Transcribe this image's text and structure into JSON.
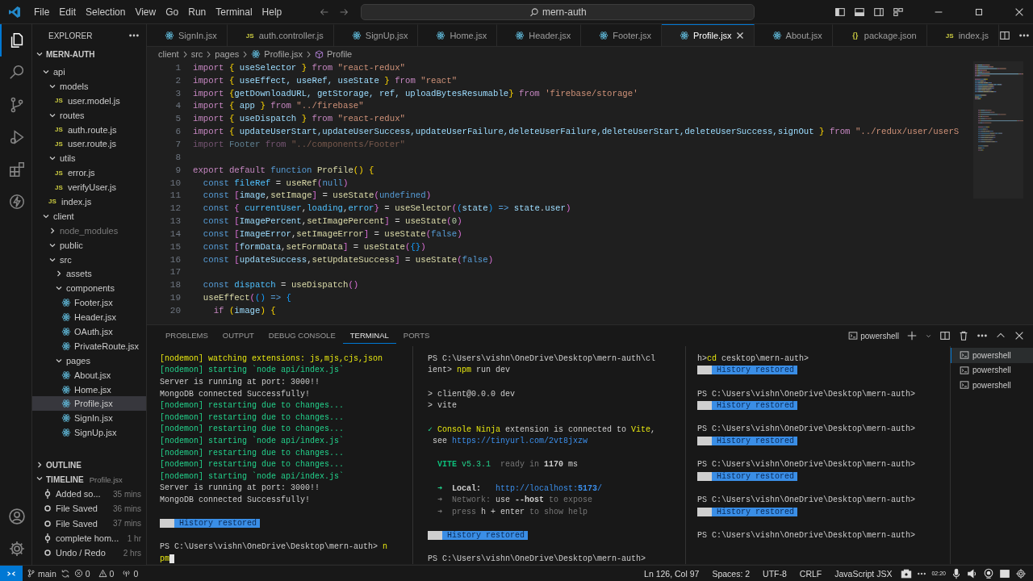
{
  "menu": [
    "File",
    "Edit",
    "Selection",
    "View",
    "Go",
    "Run",
    "Terminal",
    "Help"
  ],
  "command_center": {
    "value": "mern-auth"
  },
  "activity_bar": [
    {
      "kind": "files",
      "selected": true
    },
    {
      "kind": "search",
      "selected": false
    },
    {
      "kind": "branch",
      "selected": false
    },
    {
      "kind": "debug",
      "selected": false
    },
    {
      "kind": "extensions",
      "selected": false
    },
    {
      "kind": "bolt",
      "selected": false
    }
  ],
  "sidebar": {
    "title": "EXPLORER",
    "project": "MERN-AUTH",
    "tree": [
      {
        "name": "api",
        "kind": "folder",
        "expanded": true,
        "selected": false,
        "children": [
          {
            "name": "models",
            "kind": "folder",
            "expanded": true,
            "selected": false,
            "children": [
              {
                "name": "user.model.js",
                "kind": "js",
                "icon_text": "JS",
                "selected": false
              }
            ]
          },
          {
            "name": "routes",
            "kind": "folder",
            "expanded": true,
            "selected": false,
            "children": [
              {
                "name": "auth.route.js",
                "kind": "js",
                "icon_text": "JS",
                "selected": false
              },
              {
                "name": "user.route.js",
                "kind": "js",
                "icon_text": "JS",
                "selected": false
              }
            ]
          },
          {
            "name": "utils",
            "kind": "folder",
            "expanded": true,
            "selected": false,
            "children": [
              {
                "name": "error.js",
                "kind": "js",
                "icon_text": "JS",
                "selected": false
              },
              {
                "name": "verifyUser.js",
                "kind": "js",
                "icon_text": "JS",
                "selected": false
              }
            ]
          },
          {
            "name": "index.js",
            "kind": "js",
            "icon_text": "JS",
            "selected": false
          }
        ]
      },
      {
        "name": "client",
        "kind": "folder",
        "expanded": true,
        "selected": false,
        "children": [
          {
            "name": "node_modules",
            "kind": "folder",
            "expanded": false,
            "ignored": true,
            "selected": false
          },
          {
            "name": "public",
            "kind": "folder",
            "expanded": true,
            "selected": false
          },
          {
            "name": "src",
            "kind": "folder",
            "expanded": true,
            "selected": false,
            "children": [
              {
                "name": "assets",
                "kind": "folder",
                "expanded": false,
                "selected": false
              },
              {
                "name": "components",
                "kind": "folder",
                "expanded": true,
                "selected": false,
                "children": [
                  {
                    "name": "Footer.jsx",
                    "kind": "react",
                    "selected": false
                  },
                  {
                    "name": "Header.jsx",
                    "kind": "react",
                    "selected": false
                  },
                  {
                    "name": "OAuth.jsx",
                    "kind": "react",
                    "selected": false
                  },
                  {
                    "name": "PrivateRoute.jsx",
                    "kind": "react",
                    "selected": false
                  }
                ]
              },
              {
                "name": "pages",
                "kind": "folder",
                "expanded": true,
                "selected": false,
                "children": [
                  {
                    "name": "About.jsx",
                    "kind": "react",
                    "selected": false
                  },
                  {
                    "name": "Home.jsx",
                    "kind": "react",
                    "selected": false
                  },
                  {
                    "name": "Profile.jsx",
                    "kind": "react",
                    "selected": true
                  },
                  {
                    "name": "SignIn.jsx",
                    "kind": "react",
                    "selected": false
                  },
                  {
                    "name": "SignUp.jsx",
                    "kind": "react",
                    "selected": false
                  }
                ]
              }
            ]
          }
        ]
      }
    ],
    "outline": {
      "title": "OUTLINE",
      "expanded": false
    },
    "timeline": {
      "title": "TIMELINE",
      "file": "Profile.jsx",
      "expanded": true,
      "items": [
        {
          "label": "Added so...",
          "time": "35 mins",
          "kind": "commit"
        },
        {
          "label": "File Saved",
          "time": "36 mins",
          "kind": "save"
        },
        {
          "label": "File Saved",
          "time": "37 mins",
          "kind": "save"
        },
        {
          "label": "complete hom...",
          "time": "1 hr",
          "kind": "commit"
        },
        {
          "label": "Undo / Redo",
          "time": "2 hrs",
          "kind": "save"
        }
      ]
    }
  },
  "tabs": [
    {
      "label": "SignIn.jsx",
      "kind": "react",
      "selected": false
    },
    {
      "label": "auth.controller.js",
      "kind": "js",
      "icon_text": "JS",
      "selected": false
    },
    {
      "label": "SignUp.jsx",
      "kind": "react",
      "selected": false
    },
    {
      "label": "Home.jsx",
      "kind": "react",
      "selected": false
    },
    {
      "label": "Header.jsx",
      "kind": "react",
      "selected": false
    },
    {
      "label": "Footer.jsx",
      "kind": "react",
      "selected": false
    },
    {
      "label": "Profile.jsx",
      "kind": "react",
      "selected": true
    },
    {
      "label": "About.jsx",
      "kind": "react",
      "selected": false
    },
    {
      "label": "package.json",
      "kind": "json",
      "icon_text": "{}",
      "selected": false
    },
    {
      "label": "index.js",
      "kind": "js",
      "icon_text": "JS",
      "selected": false
    }
  ],
  "breadcrumb": [
    "client",
    "src",
    "pages",
    "Profile.jsx",
    "Profile"
  ],
  "code": [
    {
      "n": "1",
      "tokens": [
        {
          "text": "import",
          "kind": "kw"
        },
        {
          "text": " {",
          "kind": "b1"
        },
        {
          "text": " useSelector ",
          "kind": "v"
        },
        {
          "text": "}",
          "kind": "b1"
        },
        {
          "text": " from ",
          "kind": "kw"
        },
        {
          "text": "\"react-redux\"",
          "kind": "s"
        }
      ]
    },
    {
      "n": "2",
      "tokens": [
        {
          "text": "import",
          "kind": "kw"
        },
        {
          "text": " {",
          "kind": "b1"
        },
        {
          "text": " useEffect, useRef, useState ",
          "kind": "v"
        },
        {
          "text": "}",
          "kind": "b1"
        },
        {
          "text": " from ",
          "kind": "kw"
        },
        {
          "text": "\"react\"",
          "kind": "s"
        }
      ]
    },
    {
      "n": "3",
      "tokens": [
        {
          "text": "import",
          "kind": "kw"
        },
        {
          "text": " {",
          "kind": "b1"
        },
        {
          "text": "getDownloadURL, getStorage, ref, uploadBytesResumable",
          "kind": "v"
        },
        {
          "text": "}",
          "kind": "b1"
        },
        {
          "text": " from ",
          "kind": "kw"
        },
        {
          "text": "'firebase/storage'",
          "kind": "s"
        }
      ]
    },
    {
      "n": "4",
      "tokens": [
        {
          "text": "import",
          "kind": "kw"
        },
        {
          "text": " {",
          "kind": "b1"
        },
        {
          "text": " app ",
          "kind": "v"
        },
        {
          "text": "}",
          "kind": "b1"
        },
        {
          "text": " from ",
          "kind": "kw"
        },
        {
          "text": "\"../firebase\"",
          "kind": "s"
        }
      ]
    },
    {
      "n": "5",
      "tokens": [
        {
          "text": "import",
          "kind": "kw"
        },
        {
          "text": " {",
          "kind": "b1"
        },
        {
          "text": " useDispatch ",
          "kind": "v"
        },
        {
          "text": "}",
          "kind": "b1"
        },
        {
          "text": " from ",
          "kind": "kw"
        },
        {
          "text": "\"react-redux\"",
          "kind": "s"
        }
      ]
    },
    {
      "n": "6",
      "tokens": [
        {
          "text": "import",
          "kind": "kw"
        },
        {
          "text": " {",
          "kind": "b1"
        },
        {
          "text": " updateUserStart,updateUserSuccess,updateUserFailure,deleteUserFailure,deleteUserStart,deleteUserSuccess,signOut ",
          "kind": "v"
        },
        {
          "text": "}",
          "kind": "b1"
        },
        {
          "text": " from ",
          "kind": "kw"
        },
        {
          "text": "\"../redux/user/userS",
          "kind": "s"
        }
      ]
    },
    {
      "n": "7",
      "unused": true,
      "tokens": [
        {
          "text": "import",
          "kind": "kw"
        },
        {
          "text": " Footer",
          "kind": "v"
        },
        {
          "text": " from ",
          "kind": "kw"
        },
        {
          "text": "\"../components/Footer\"",
          "kind": "s"
        }
      ]
    },
    {
      "n": "8"
    },
    {
      "n": "9",
      "tokens": [
        {
          "text": "export default ",
          "kind": "kw"
        },
        {
          "text": "function ",
          "kind": "st"
        },
        {
          "text": "Profile",
          "kind": "f"
        },
        {
          "text": "() {",
          "kind": "b1"
        }
      ]
    },
    {
      "n": "10",
      "tokens": [
        {
          "text": "  const ",
          "kind": "st"
        },
        {
          "text": "fileRef",
          "kind": "c"
        },
        {
          "text": " = ",
          "kind": "p"
        },
        {
          "text": "useRef",
          "kind": "f"
        },
        {
          "text": "(",
          "kind": "b2"
        },
        {
          "text": "null",
          "kind": "st"
        },
        {
          "text": ")",
          "kind": "b2"
        }
      ]
    },
    {
      "n": "11",
      "tokens": [
        {
          "text": "  const ",
          "kind": "st"
        },
        {
          "text": "[",
          "kind": "b2"
        },
        {
          "text": "image",
          "kind": "v"
        },
        {
          "text": ",",
          "kind": "p"
        },
        {
          "text": "setImage",
          "kind": "f"
        },
        {
          "text": "]",
          "kind": "b2"
        },
        {
          "text": " = ",
          "kind": "p"
        },
        {
          "text": "useState",
          "kind": "f"
        },
        {
          "text": "(",
          "kind": "b2"
        },
        {
          "text": "undefined",
          "kind": "st"
        },
        {
          "text": ")",
          "kind": "b2"
        }
      ]
    },
    {
      "n": "12",
      "tokens": [
        {
          "text": "  const ",
          "kind": "st"
        },
        {
          "text": "{",
          "kind": "b2"
        },
        {
          "text": " currentUser",
          "kind": "c"
        },
        {
          "text": ",",
          "kind": "p"
        },
        {
          "text": "loading",
          "kind": "c"
        },
        {
          "text": ",",
          "kind": "p"
        },
        {
          "text": "error",
          "kind": "c"
        },
        {
          "text": "}",
          "kind": "b2"
        },
        {
          "text": " = ",
          "kind": "p"
        },
        {
          "text": "useSelector",
          "kind": "f"
        },
        {
          "text": "(",
          "kind": "b2"
        },
        {
          "text": "(",
          "kind": "b3"
        },
        {
          "text": "state",
          "kind": "v"
        },
        {
          "text": ")",
          "kind": "b3"
        },
        {
          "text": " => ",
          "kind": "st"
        },
        {
          "text": "state",
          "kind": "v"
        },
        {
          "text": ".",
          "kind": "p"
        },
        {
          "text": "user",
          "kind": "v"
        },
        {
          "text": ")",
          "kind": "b2"
        }
      ]
    },
    {
      "n": "13",
      "tokens": [
        {
          "text": "  const ",
          "kind": "st"
        },
        {
          "text": "[",
          "kind": "b2"
        },
        {
          "text": "ImagePercent",
          "kind": "v"
        },
        {
          "text": ",",
          "kind": "p"
        },
        {
          "text": "setImagePercent",
          "kind": "f"
        },
        {
          "text": "]",
          "kind": "b2"
        },
        {
          "text": " = ",
          "kind": "p"
        },
        {
          "text": "useState",
          "kind": "f"
        },
        {
          "text": "(",
          "kind": "b2"
        },
        {
          "text": "0",
          "kind": "num"
        },
        {
          "text": ")",
          "kind": "b2"
        }
      ]
    },
    {
      "n": "14",
      "tokens": [
        {
          "text": "  const ",
          "kind": "st"
        },
        {
          "text": "[",
          "kind": "b2"
        },
        {
          "text": "ImageError",
          "kind": "v"
        },
        {
          "text": ",",
          "kind": "p"
        },
        {
          "text": "setImageError",
          "kind": "f"
        },
        {
          "text": "]",
          "kind": "b2"
        },
        {
          "text": " = ",
          "kind": "p"
        },
        {
          "text": "useState",
          "kind": "f"
        },
        {
          "text": "(",
          "kind": "b2"
        },
        {
          "text": "false",
          "kind": "st"
        },
        {
          "text": ")",
          "kind": "b2"
        }
      ]
    },
    {
      "n": "15",
      "tokens": [
        {
          "text": "  const ",
          "kind": "st"
        },
        {
          "text": "[",
          "kind": "b2"
        },
        {
          "text": "formData",
          "kind": "v"
        },
        {
          "text": ",",
          "kind": "p"
        },
        {
          "text": "setFormData",
          "kind": "f"
        },
        {
          "text": "]",
          "kind": "b2"
        },
        {
          "text": " = ",
          "kind": "p"
        },
        {
          "text": "useState",
          "kind": "f"
        },
        {
          "text": "(",
          "kind": "b2"
        },
        {
          "text": "{}",
          "kind": "b3"
        },
        {
          "text": ")",
          "kind": "b2"
        }
      ]
    },
    {
      "n": "16",
      "tokens": [
        {
          "text": "  const ",
          "kind": "st"
        },
        {
          "text": "[",
          "kind": "b2"
        },
        {
          "text": "updateSuccess",
          "kind": "v"
        },
        {
          "text": ",",
          "kind": "p"
        },
        {
          "text": "setUpdateSuccess",
          "kind": "f"
        },
        {
          "text": "]",
          "kind": "b2"
        },
        {
          "text": " = ",
          "kind": "p"
        },
        {
          "text": "useState",
          "kind": "f"
        },
        {
          "text": "(",
          "kind": "b2"
        },
        {
          "text": "false",
          "kind": "st"
        },
        {
          "text": ")",
          "kind": "b2"
        }
      ]
    },
    {
      "n": "17"
    },
    {
      "n": "18",
      "tokens": [
        {
          "text": "  const ",
          "kind": "st"
        },
        {
          "text": "dispatch",
          "kind": "c"
        },
        {
          "text": " = ",
          "kind": "p"
        },
        {
          "text": "useDispatch",
          "kind": "f"
        },
        {
          "text": "()",
          "kind": "b2"
        }
      ]
    },
    {
      "n": "19",
      "tokens": [
        {
          "text": "  useEffect",
          "kind": "f"
        },
        {
          "text": "(",
          "kind": "b2"
        },
        {
          "text": "()",
          "kind": "b3"
        },
        {
          "text": " => ",
          "kind": "st"
        },
        {
          "text": "{",
          "kind": "b3"
        }
      ]
    },
    {
      "n": "20",
      "tokens": [
        {
          "text": "    if ",
          "kind": "kw"
        },
        {
          "text": "(",
          "kind": "b1"
        },
        {
          "text": "image",
          "kind": "v"
        },
        {
          "text": ") {",
          "kind": "b1"
        }
      ]
    }
  ],
  "panel": {
    "tabs": [
      {
        "label": "PROBLEMS",
        "selected": false
      },
      {
        "label": "OUTPUT",
        "selected": false
      },
      {
        "label": "DEBUG CONSOLE",
        "selected": false
      },
      {
        "label": "TERMINAL",
        "selected": true
      },
      {
        "label": "PORTS",
        "selected": false
      }
    ],
    "shell_label": "powershell",
    "sessions": [
      {
        "label": "powershell",
        "selected": true
      },
      {
        "label": "powershell",
        "selected": false
      },
      {
        "label": "powershell",
        "selected": false
      }
    ],
    "panes": [
      {
        "lines": [
          {
            "kind": "text",
            "segs": [
              {
                "text": "[nodemon] watching extensions: js,mjs,cjs,json",
                "kind": "yellow"
              }
            ]
          },
          {
            "kind": "text",
            "segs": [
              {
                "text": "[nodemon] starting `node api/index.js`",
                "kind": "green"
              }
            ]
          },
          {
            "kind": "text",
            "segs": [
              {
                "text": "Server is running at port: 3000!!",
                "kind": "plain"
              }
            ]
          },
          {
            "kind": "text",
            "segs": [
              {
                "text": "MongoDB connected Successfully!",
                "kind": "plain"
              }
            ]
          },
          {
            "kind": "text",
            "segs": [
              {
                "text": "[nodemon] restarting due to changes...",
                "kind": "green"
              }
            ]
          },
          {
            "kind": "text",
            "segs": [
              {
                "text": "[nodemon] restarting due to changes...",
                "kind": "green"
              }
            ]
          },
          {
            "kind": "text",
            "segs": [
              {
                "text": "[nodemon] restarting due to changes...",
                "kind": "green"
              }
            ]
          },
          {
            "kind": "text",
            "segs": [
              {
                "text": "[nodemon] starting `node api/index.js`",
                "kind": "green"
              }
            ]
          },
          {
            "kind": "text",
            "segs": [
              {
                "text": "[nodemon] restarting due to changes...",
                "kind": "green"
              }
            ]
          },
          {
            "kind": "text",
            "segs": [
              {
                "text": "[nodemon] restarting due to changes...",
                "kind": "green"
              }
            ]
          },
          {
            "kind": "text",
            "segs": [
              {
                "text": "[nodemon] starting `node api/index.js`",
                "kind": "green"
              }
            ]
          },
          {
            "kind": "text",
            "segs": [
              {
                "text": "Server is running at port: 3000!!",
                "kind": "plain"
              }
            ]
          },
          {
            "kind": "text",
            "segs": [
              {
                "text": "MongoDB connected Successfully!",
                "kind": "plain"
              }
            ]
          },
          {
            "kind": "blank"
          },
          {
            "kind": "badge",
            "text": "History restored"
          },
          {
            "kind": "blank"
          },
          {
            "kind": "text",
            "segs": [
              {
                "text": "PS C:\\Users\\vishn\\OneDrive\\Desktop\\mern-auth> ",
                "kind": "plain"
              },
              {
                "text": "n",
                "kind": "yellow"
              }
            ]
          },
          {
            "kind": "text",
            "segs": [
              {
                "text": "pm",
                "kind": "yellow"
              }
            ],
            "cursor": true
          }
        ]
      },
      {
        "lines": [
          {
            "kind": "text",
            "segs": [
              {
                "text": "PS C:\\Users\\vishn\\OneDrive\\Desktop\\mern-auth\\cl",
                "kind": "plain"
              }
            ]
          },
          {
            "kind": "text",
            "segs": [
              {
                "text": "ient> ",
                "kind": "plain"
              },
              {
                "text": "npm",
                "kind": "yellow"
              },
              {
                "text": " run dev",
                "kind": "plain"
              }
            ]
          },
          {
            "kind": "blank"
          },
          {
            "kind": "text",
            "segs": [
              {
                "text": "> client@0.0.0 dev",
                "kind": "plain"
              }
            ]
          },
          {
            "kind": "text",
            "segs": [
              {
                "text": "> vite",
                "kind": "plain"
              }
            ]
          },
          {
            "kind": "blank"
          },
          {
            "kind": "text",
            "segs": [
              {
                "text": "✓ ",
                "kind": "green"
              },
              {
                "text": "Console Ninja",
                "kind": "yellow"
              },
              {
                "text": " extension is connected to ",
                "kind": "plain"
              },
              {
                "text": "Vite",
                "kind": "yellow"
              },
              {
                "text": ",",
                "kind": "plain"
              }
            ]
          },
          {
            "kind": "text",
            "segs": [
              {
                "text": " see ",
                "kind": "plain"
              },
              {
                "text": "https://tinyurl.com/2vt8jxzw",
                "kind": "link"
              }
            ]
          },
          {
            "kind": "blank"
          },
          {
            "kind": "text",
            "segs": [
              {
                "text": "  VITE",
                "kind": "greenbold"
              },
              {
                "text": " v5.3.1",
                "kind": "green"
              },
              {
                "text": "  ready in ",
                "kind": "dim"
              },
              {
                "text": "1170",
                "kind": "bold"
              },
              {
                "text": " ms",
                "kind": "plain"
              }
            ]
          },
          {
            "kind": "blank"
          },
          {
            "kind": "text",
            "segs": [
              {
                "text": "  ➜",
                "kind": "green"
              },
              {
                "text": "  Local:",
                "kind": "bold"
              },
              {
                "text": "   http://localhost:",
                "kind": "link"
              },
              {
                "text": "5173",
                "kind": "linkbold"
              },
              {
                "text": "/",
                "kind": "link"
              }
            ]
          },
          {
            "kind": "text",
            "segs": [
              {
                "text": "  ➜  Network: ",
                "kind": "dim"
              },
              {
                "text": "use ",
                "kind": "plain"
              },
              {
                "text": "--host",
                "kind": "bold"
              },
              {
                "text": " to expose",
                "kind": "dim"
              }
            ]
          },
          {
            "kind": "text",
            "segs": [
              {
                "text": "  ➜  press ",
                "kind": "dim"
              },
              {
                "text": "h + enter",
                "kind": "plain"
              },
              {
                "text": " to show help",
                "kind": "dim"
              }
            ]
          },
          {
            "kind": "blank"
          },
          {
            "kind": "badge",
            "text": "History restored"
          },
          {
            "kind": "blank"
          },
          {
            "kind": "text",
            "segs": [
              {
                "text": "PS C:\\Users\\vishn\\OneDrive\\Desktop\\mern-auth>",
                "kind": "plain"
              }
            ]
          }
        ]
      },
      {
        "lines": [
          {
            "kind": "text",
            "segs": [
              {
                "text": "h>",
                "kind": "plain"
              },
              {
                "text": "cd",
                "kind": "yellow"
              },
              {
                "text": " cesktop\\mern-auth>",
                "kind": "plain"
              }
            ]
          },
          {
            "kind": "badge",
            "text": "History restored"
          },
          {
            "kind": "blank"
          },
          {
            "kind": "text",
            "segs": [
              {
                "text": "PS C:\\Users\\vishn\\OneDrive\\Desktop\\mern-auth>",
                "kind": "plain"
              }
            ]
          },
          {
            "kind": "badge",
            "text": "History restored"
          },
          {
            "kind": "blank"
          },
          {
            "kind": "text",
            "segs": [
              {
                "text": "PS C:\\Users\\vishn\\OneDrive\\Desktop\\mern-auth>",
                "kind": "plain"
              }
            ]
          },
          {
            "kind": "badge",
            "text": "History restored"
          },
          {
            "kind": "blank"
          },
          {
            "kind": "text",
            "segs": [
              {
                "text": "PS C:\\Users\\vishn\\OneDrive\\Desktop\\mern-auth>",
                "kind": "plain"
              }
            ]
          },
          {
            "kind": "badge",
            "text": "History restored"
          },
          {
            "kind": "blank"
          },
          {
            "kind": "text",
            "segs": [
              {
                "text": "PS C:\\Users\\vishn\\OneDrive\\Desktop\\mern-auth>",
                "kind": "plain"
              }
            ]
          },
          {
            "kind": "badge",
            "text": "History restored"
          },
          {
            "kind": "blank"
          },
          {
            "kind": "text",
            "segs": [
              {
                "text": "PS C:\\Users\\vishn\\OneDrive\\Desktop\\mern-auth>",
                "kind": "plain"
              }
            ]
          }
        ]
      }
    ]
  },
  "status_bar": {
    "branch": "main",
    "errors": "0",
    "warnings": "0",
    "ports": "0",
    "position": "Ln 126, Col 97",
    "indent": "Spaces: 2",
    "encoding": "UTF-8",
    "eol": "CRLF",
    "language": "JavaScript JSX",
    "clock": "02:20"
  }
}
